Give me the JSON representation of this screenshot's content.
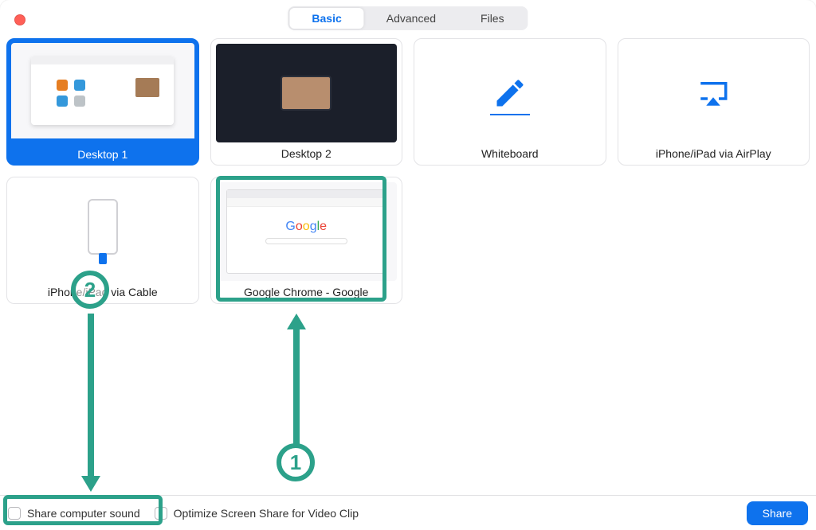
{
  "tabs": {
    "basic": "Basic",
    "advanced": "Advanced",
    "files": "Files"
  },
  "tiles": {
    "desktop1": "Desktop 1",
    "desktop2": "Desktop 2",
    "whiteboard": "Whiteboard",
    "airplay": "iPhone/iPad via AirPlay",
    "cable": "iPhone/iPad via Cable",
    "chrome": "Google Chrome - Google",
    "chrome_logo": "Google"
  },
  "bottom": {
    "share_sound": "Share computer sound",
    "optimize": "Optimize Screen Share for Video Clip",
    "share": "Share"
  },
  "annotations": {
    "step1": "1",
    "step2": "2"
  },
  "colors": {
    "accent": "#0e72ed",
    "annotation": "#2ca18a"
  }
}
